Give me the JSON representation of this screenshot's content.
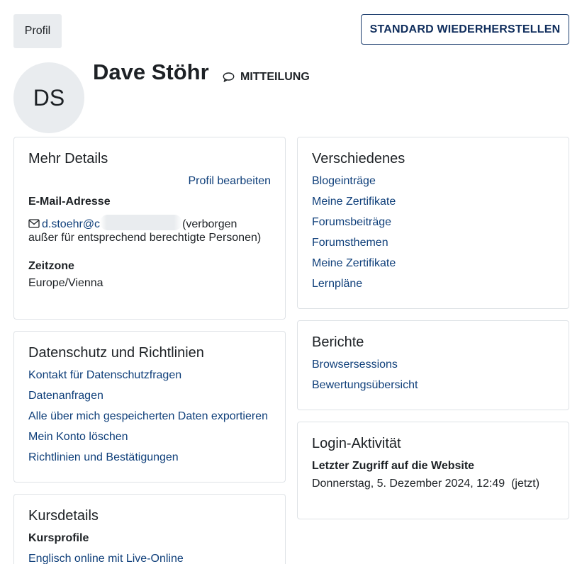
{
  "header": {
    "profile_tab": "Profil",
    "reset_button": "STANDARD WIEDERHERSTELLEN"
  },
  "user": {
    "initials": "DS",
    "name": "Dave Stöhr",
    "message_label": "MITTEILUNG"
  },
  "more_details": {
    "title": "Mehr Details",
    "edit_link": "Profil bearbeiten",
    "email_label": "E-Mail-Adresse",
    "email_value": "d.stoehr@c",
    "email_note_1": "(verborgen",
    "email_note_2": "außer für entsprechend berechtigte Personen)",
    "timezone_label": "Zeitzone",
    "timezone_value": "Europe/Vienna"
  },
  "misc": {
    "title": "Verschiedenes",
    "links": [
      "Blogeinträge",
      "Meine Zertifikate",
      "Forumsbeiträge",
      "Forumsthemen",
      "Meine Zertifikate",
      "Lernpläne"
    ]
  },
  "privacy": {
    "title": "Datenschutz und Richtlinien",
    "links": [
      "Kontakt für Datenschutzfragen",
      "Datenanfragen",
      "Alle über mich gespeicherten Daten exportieren",
      "Mein Konto löschen",
      "Richtlinien und Bestätigungen"
    ]
  },
  "reports": {
    "title": "Berichte",
    "links": [
      "Browsersessions",
      "Bewertungsübersicht"
    ]
  },
  "login": {
    "title": "Login-Aktivität",
    "last_access_label": "Letzter Zugriff auf die Website",
    "last_access_value": "Donnerstag, 5. Dezember 2024, 12:49  (jetzt)"
  },
  "course_details": {
    "title": "Kursdetails",
    "profiles_label": "Kursprofile",
    "course_link": "Englisch online mit Live-Online"
  }
}
